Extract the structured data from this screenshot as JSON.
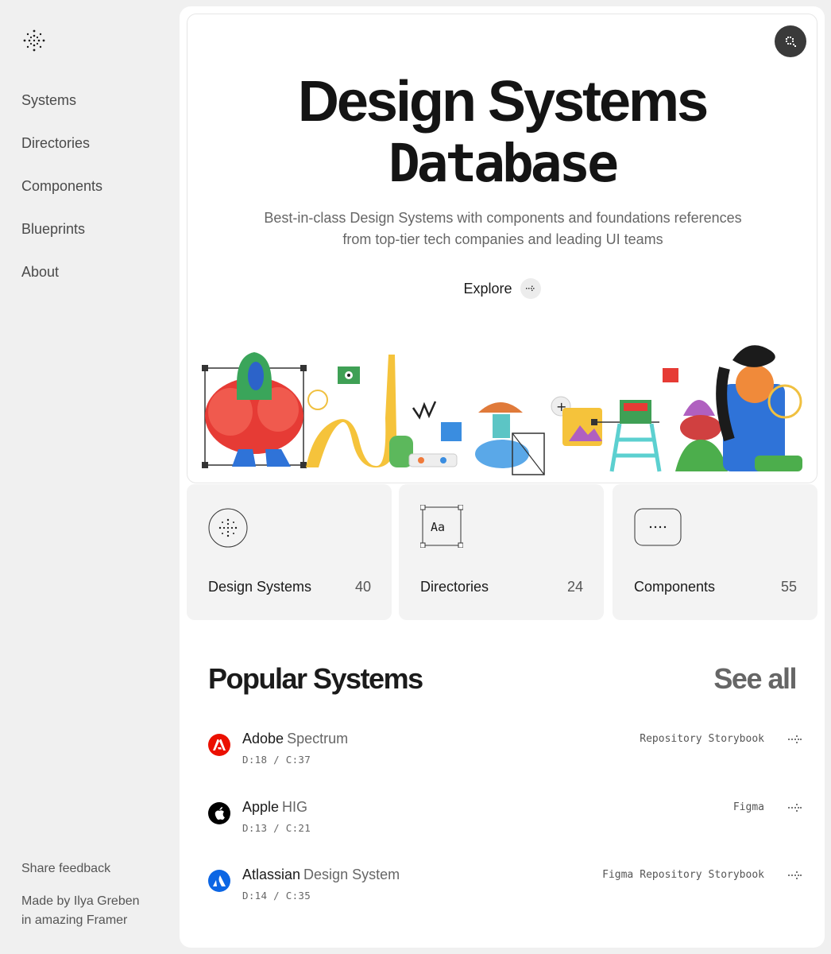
{
  "sidebar": {
    "nav": [
      "Systems",
      "Directories",
      "Components",
      "Blueprints",
      "About"
    ],
    "feedback": "Share feedback",
    "made_by_1": "Made by Ilya Greben",
    "made_by_2": "in amazing Framer"
  },
  "hero": {
    "title_line1": "Design Systems",
    "title_line2": "Database",
    "subtitle_line1": "Best-in-class Design Systems with components and foundations references",
    "subtitle_line2": "from top-tier tech companies and leading UI teams",
    "explore_label": "Explore"
  },
  "cards": [
    {
      "label": "Design Systems",
      "count": "40",
      "icon": "dots-logo-icon"
    },
    {
      "label": "Directories",
      "count": "24",
      "icon": "typography-aa-icon"
    },
    {
      "label": "Components",
      "count": "55",
      "icon": "ellipsis-button-icon"
    }
  ],
  "popular": {
    "title": "Popular Systems",
    "see_all": "See all",
    "rows": [
      {
        "brand": "Adobe",
        "system": "Spectrum",
        "meta": "D:18 / C:37",
        "links": [
          "Repository",
          "Storybook"
        ],
        "color": "#eb1000"
      },
      {
        "brand": "Apple",
        "system": "HIG",
        "meta": "D:13 / C:21",
        "links": [
          "Figma"
        ],
        "color": "#000000"
      },
      {
        "brand": "Atlassian",
        "system": "Design System",
        "meta": "D:14 / C:35",
        "links": [
          "Figma",
          "Repository",
          "Storybook"
        ],
        "color": "#0c66e4"
      }
    ]
  },
  "colors": {
    "background": "#f0f0f0",
    "panel": "#ffffff",
    "card": "#f3f3f3",
    "text": "#1b1b1b"
  }
}
